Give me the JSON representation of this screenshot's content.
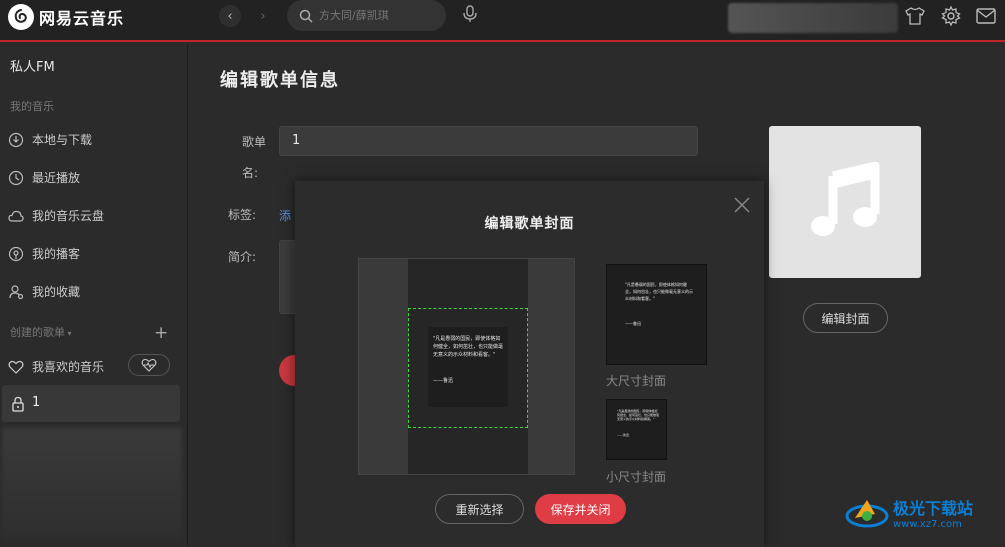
{
  "app": {
    "name": "网易云音乐"
  },
  "search": {
    "placeholder": "方大同/薛凯琪"
  },
  "sidebar": {
    "fm_label": "私人FM",
    "my_music_header": "我的音乐",
    "items": [
      {
        "label": "本地与下载",
        "icon": "download-icon"
      },
      {
        "label": "最近播放",
        "icon": "clock-icon"
      },
      {
        "label": "我的音乐云盘",
        "icon": "cloud-icon"
      },
      {
        "label": "我的播客",
        "icon": "podcast-icon"
      },
      {
        "label": "我的收藏",
        "icon": "collection-icon"
      }
    ],
    "created_header": "创建的歌单",
    "playlists": [
      {
        "label": "我喜欢的音乐",
        "icon": "heart-icon"
      },
      {
        "label": "1",
        "icon": "lock-icon"
      }
    ]
  },
  "edit_page": {
    "title": "编辑歌单信息",
    "name_label_line1": "歌单",
    "name_label_line2": "名:",
    "name_value": "1",
    "tag_label": "标签:",
    "tag_peek": "添",
    "desc_label": "简介:",
    "edit_cover_button": "编辑封面"
  },
  "cover_modal": {
    "title": "编辑歌单封面",
    "large_label": "大尺寸封面",
    "small_label": "小尺寸封面",
    "reselect_button": "重新选择",
    "save_button": "保存并关闭",
    "quote_text": "\"凡是愚弱的国民，即使体格如何健全，如何茁壮，也只能做毫无意义的示众材料和看客。\"",
    "quote_author": "——鲁迅"
  },
  "watermark": {
    "title": "极光下载站",
    "url": "www.xz7.com"
  },
  "colors": {
    "accent": "#c2242b",
    "save": "#e03c45",
    "crop_border": "#3fd43f",
    "watermark": "#0a7fd6"
  }
}
